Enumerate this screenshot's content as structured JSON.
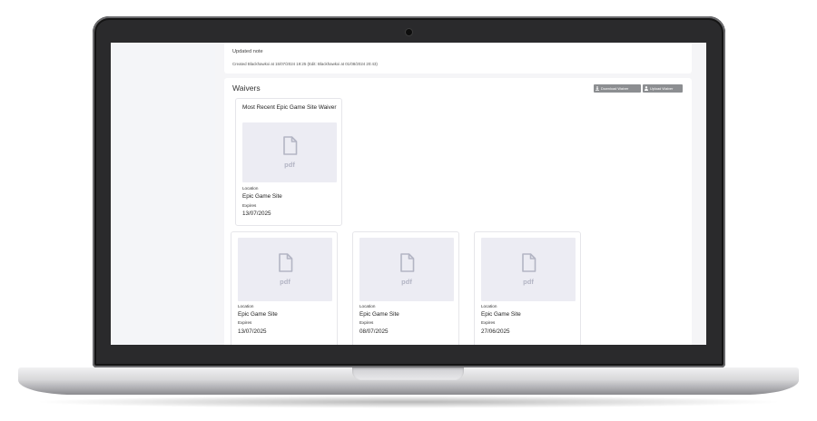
{
  "note": {
    "text": "Updated note",
    "meta": "Created Blackhawkxi at 15/07/2024 19:25 (Edit: Blackhawkxi at 01/08/2024 20:43)"
  },
  "waivers": {
    "title": "Waivers",
    "download_label": "Download Waiver",
    "upload_label": "Upload Waiver",
    "featured": {
      "title": "Most Recent Epic Game Site Waiver",
      "file_type": "pdf",
      "location_label": "Location",
      "location": "Epic Game Site",
      "expires_label": "Expires",
      "expires": "13/07/2025"
    },
    "items": [
      {
        "file_type": "pdf",
        "location_label": "Location",
        "location": "Epic Game Site",
        "expires_label": "Expires",
        "expires": "13/07/2025"
      },
      {
        "file_type": "pdf",
        "location_label": "Location",
        "location": "Epic Game Site",
        "expires_label": "Expires",
        "expires": "08/07/2025"
      },
      {
        "file_type": "pdf",
        "location_label": "Location",
        "location": "Epic Game Site",
        "expires_label": "Expires",
        "expires": "27/06/2025"
      }
    ]
  },
  "icons": {
    "file": "file-icon",
    "download": "download-icon",
    "upload": "user-upload-icon",
    "camera": "camera-icon"
  },
  "colors": {
    "button_bg": "#8c8e91",
    "thumb_bg": "#ececf3",
    "screen_bg": "#f5f5f7",
    "bezel": "#2a2a2c"
  }
}
